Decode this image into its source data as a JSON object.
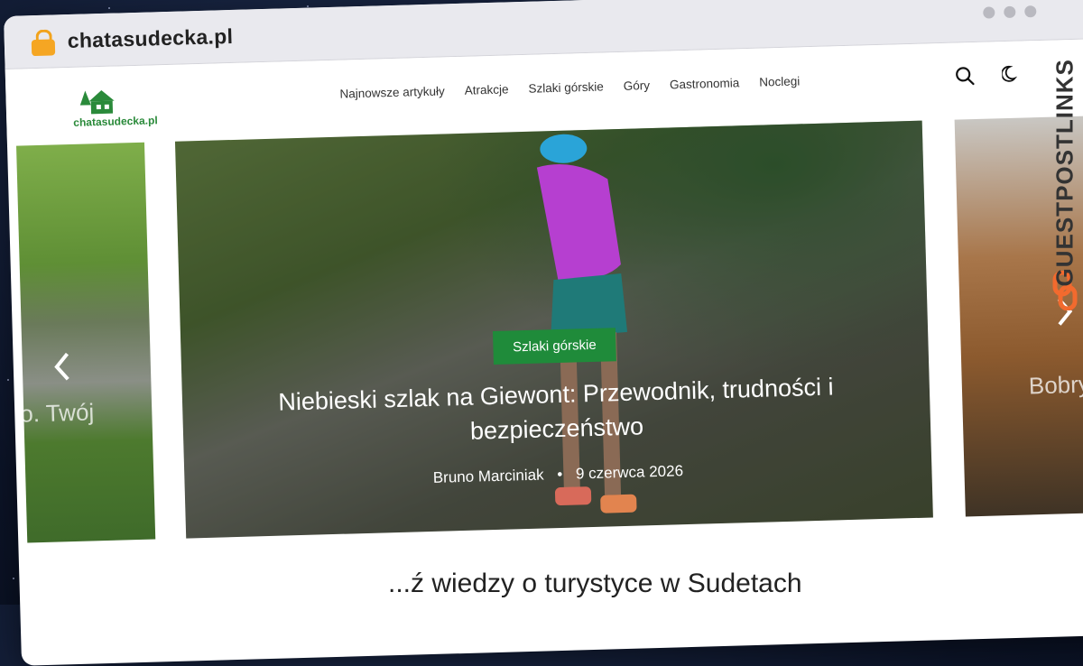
{
  "browser": {
    "url": "chatasudecka.pl"
  },
  "header": {
    "logo_text": "chatasudecka.pl",
    "nav": [
      "Najnowsze artykuły",
      "Atrakcje",
      "Szlaki górskie",
      "Góry",
      "Gastronomia",
      "Noclegi"
    ],
    "icons": [
      "search-icon",
      "moon-icon"
    ]
  },
  "slider": {
    "left_slide_text": "o. Twój",
    "right_slide_text": "Bobry",
    "main": {
      "category": "Szlaki górskie",
      "title": "Niebieski szlak na Giewont: Przewodnik, trudności i bezpieczeństwo",
      "author": "Bruno Marciniak",
      "date": "9 czerwca 2026"
    }
  },
  "bottom_headline": "...ź wiedzy o turystyce w Sudetach",
  "watermark": "GUESTPOSTLINKS",
  "colors": {
    "badge": "#1f8b3a",
    "lock": "#f5a623",
    "logo": "#2a8a3a"
  }
}
